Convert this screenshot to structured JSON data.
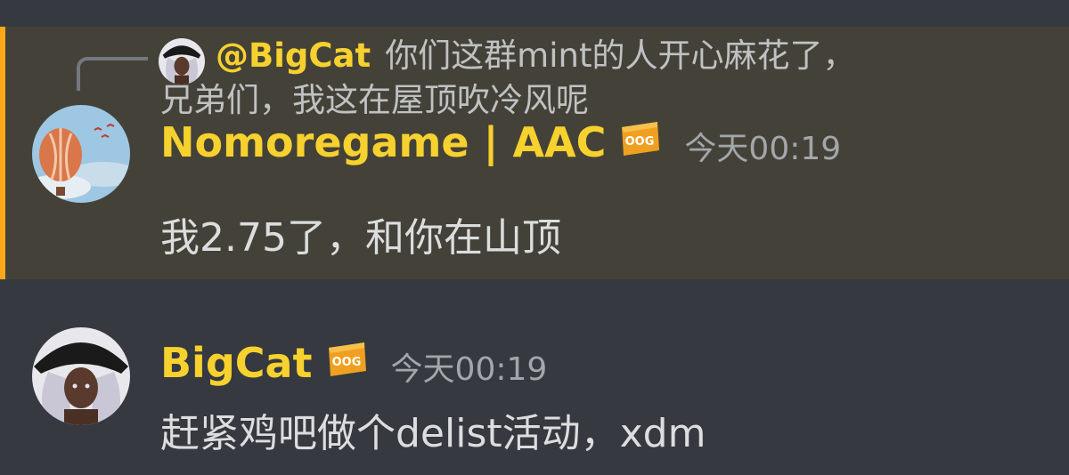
{
  "colors": {
    "background": "#36393f",
    "highlight_background": "#444238",
    "highlight_bar": "#faa81a",
    "username": "#f7d12e",
    "message_text": "#dcddde",
    "timestamp": "#a3a6aa",
    "badge": "#f0a020"
  },
  "messages": [
    {
      "highlighted": true,
      "reply": {
        "author": "@BigCat",
        "text_line1": "你们这群mint的人开心麻花了，",
        "text_line2": "兄弟们，我这在屋顶吹冷风呢",
        "avatar_icon": "witch-avatar-icon"
      },
      "author": "Nomoregame | AAC",
      "badge_icon": "community-badge-icon",
      "badge_text": "OOG",
      "timestamp": "今天00:19",
      "content": "我2.75了，和你在山顶",
      "avatar_icon": "hot-air-balloon-avatar-icon"
    },
    {
      "highlighted": false,
      "author": "BigCat",
      "badge_icon": "community-badge-icon",
      "badge_text": "OOG",
      "timestamp": "今天00:19",
      "content": "赶紧鸡吧做个delist活动，xdm",
      "avatar_icon": "witch-avatar-icon"
    }
  ]
}
